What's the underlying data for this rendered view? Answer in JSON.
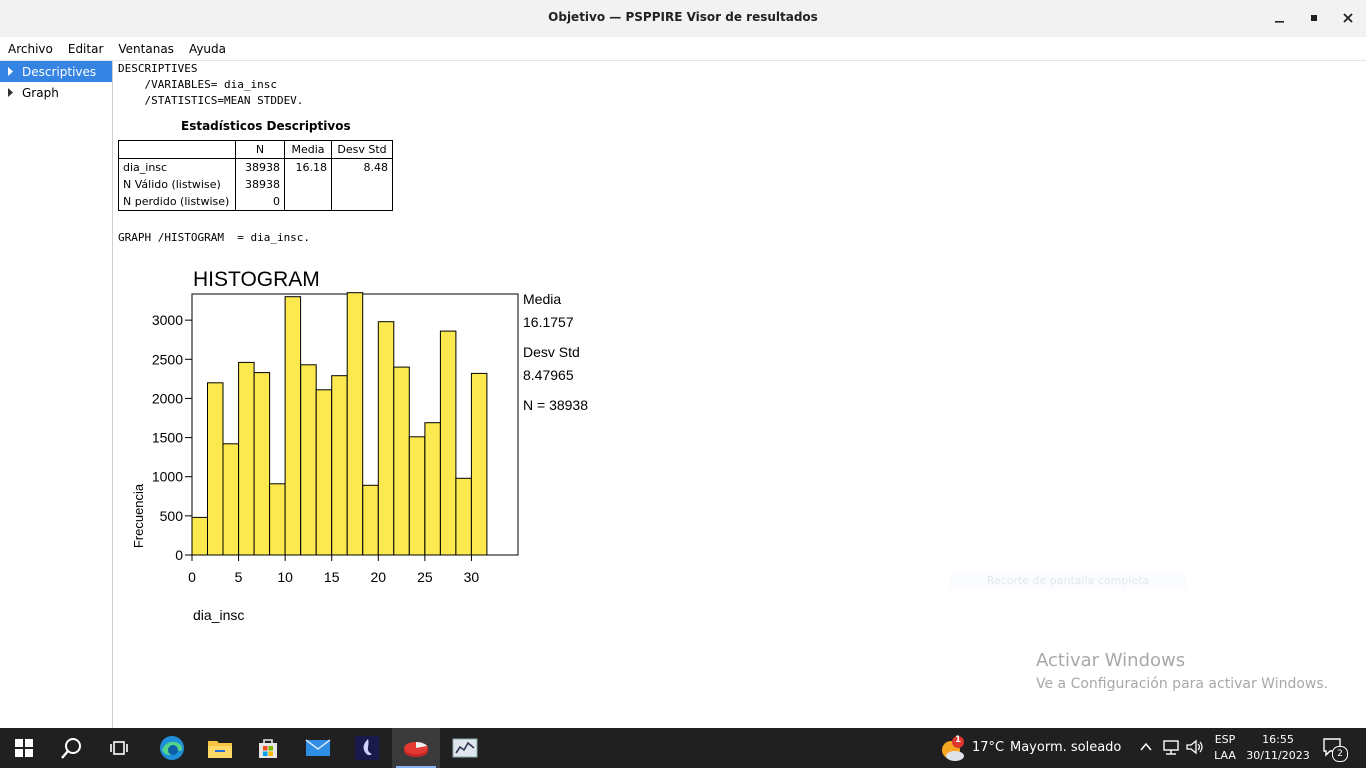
{
  "window": {
    "title": "Objetivo — PSPPIRE Visor de resultados"
  },
  "menu": {
    "items": [
      "Archivo",
      "Editar",
      "Ventanas",
      "Ayuda"
    ]
  },
  "sidebar": {
    "items": [
      {
        "label": "Descriptives",
        "selected": true
      },
      {
        "label": "Graph",
        "selected": false
      }
    ]
  },
  "output": {
    "syntax1": "DESCRIPTIVES\n    /VARIABLES= dia_insc\n    /STATISTICS=MEAN STDDEV.",
    "table_title": "Estadísticos Descriptivos",
    "table": {
      "headers": [
        "",
        "N",
        "Media",
        "Desv Std"
      ],
      "rows": [
        [
          "dia_insc",
          "38938",
          "16.18",
          "8.48"
        ],
        [
          "N Válido (listwise)",
          "38938",
          "",
          ""
        ],
        [
          "N perdido (listwise)",
          "0",
          "",
          ""
        ]
      ]
    },
    "syntax2": "GRAPH /HISTOGRAM  = dia_insc."
  },
  "chart_data": {
    "type": "bar",
    "title": "HISTOGRAM",
    "xlabel": "dia_insc",
    "ylabel": "Frecuencia",
    "xlim": [
      0,
      35
    ],
    "ylim": [
      0,
      3500
    ],
    "xticks": [
      0,
      5,
      10,
      15,
      20,
      25,
      30
    ],
    "yticks": [
      0,
      500,
      1000,
      1500,
      2000,
      2500,
      3000
    ],
    "bin_width": 1.6667,
    "bin_starts": [
      0,
      1.6667,
      3.3333,
      5,
      6.6667,
      8.3333,
      10,
      11.6667,
      13.3333,
      15,
      16.6667,
      18.3333,
      20,
      21.6667,
      23.3333,
      25,
      26.6667,
      28.3333,
      30
    ],
    "values": [
      480,
      2200,
      1420,
      2460,
      2330,
      910,
      3300,
      2430,
      2110,
      2290,
      3350,
      890,
      2980,
      2400,
      1510,
      1690,
      2860,
      980,
      2320
    ],
    "bar_color": "#fce94f",
    "legend_lines": [
      "Media",
      "16.1757",
      "Desv Std",
      "8.47965",
      "N = 38938"
    ]
  },
  "watermark": {
    "line1": "Activar Windows",
    "line2": "Ve a Configuración para activar Windows.",
    "faint_caption": "Recorte de pantalla completa"
  },
  "taskbar": {
    "icons": [
      "windows-start-icon",
      "search-icon",
      "task-view-icon",
      "edge-browser-icon",
      "file-explorer-icon",
      "microsoft-store-icon",
      "mail-icon",
      "obs-app-icon",
      "pspp-app-icon",
      "pspp-viewer-icon"
    ],
    "weather_badge": "1",
    "temperature": "17°C",
    "weather": "Mayorm. soleado",
    "lang1": "ESP",
    "lang2": "LAA",
    "time": "16:55",
    "date": "30/11/2023",
    "notification_count": "2"
  }
}
